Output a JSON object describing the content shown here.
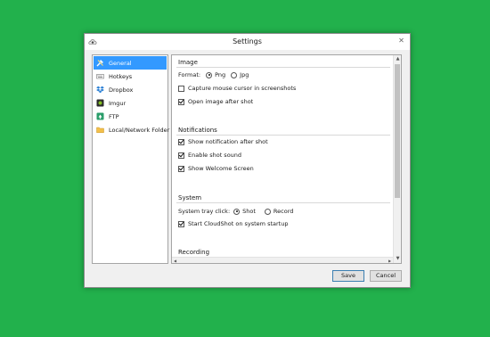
{
  "window": {
    "title": "Settings",
    "close_symbol": "✕"
  },
  "sidebar": {
    "items": [
      {
        "label": "General",
        "icon": "tools-icon",
        "active": true
      },
      {
        "label": "Hotkeys",
        "icon": "keyboard-icon",
        "active": false
      },
      {
        "label": "Dropbox",
        "icon": "dropbox-icon",
        "active": false
      },
      {
        "label": "Imgur",
        "icon": "imgur-icon",
        "active": false
      },
      {
        "label": "FTP",
        "icon": "ftp-icon",
        "active": false
      },
      {
        "label": "Local/Network Folder",
        "icon": "folder-icon",
        "active": false
      }
    ]
  },
  "image": {
    "title": "Image",
    "format_label": "Format:",
    "format_options": [
      {
        "label": "Png",
        "checked": true
      },
      {
        "label": "Jpg",
        "checked": false
      }
    ],
    "capture_cursor": {
      "label": "Capture mouse cursor in screenshots",
      "checked": false
    },
    "open_after_shot": {
      "label": "Open image after shot",
      "checked": true
    }
  },
  "notifications": {
    "title": "Notifications",
    "show_notification": {
      "label": "Show notification after shot",
      "checked": true
    },
    "shot_sound": {
      "label": "Enable shot sound",
      "checked": true
    },
    "welcome_screen": {
      "label": "Show Welcome Screen",
      "checked": true
    }
  },
  "system": {
    "title": "System",
    "tray_click_label": "System tray click:",
    "tray_options": [
      {
        "label": "Shot",
        "checked": true
      },
      {
        "label": "Record",
        "checked": false
      }
    ],
    "start_on_startup": {
      "label": "Start CloudShot on system startup",
      "checked": true
    }
  },
  "recording": {
    "title": "Recording"
  },
  "buttons": {
    "save": "Save",
    "cancel": "Cancel"
  },
  "colors": {
    "background": "#22b14c",
    "selection": "#3399ff"
  }
}
